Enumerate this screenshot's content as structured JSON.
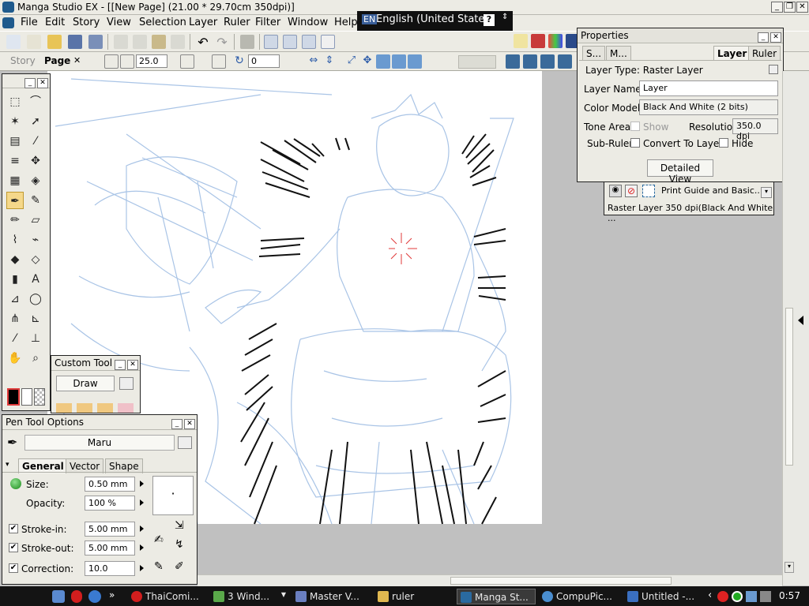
{
  "window": {
    "title": "Manga Studio EX - [[New Page] (21.00 * 29.70cm 350dpi)]",
    "minimize": "_",
    "restore": "❐",
    "close": "✕"
  },
  "menu": [
    "File",
    "Edit",
    "Story",
    "View",
    "Selection",
    "Layer",
    "Ruler",
    "Filter",
    "Window",
    "Help"
  ],
  "language_bar": {
    "code": "EN",
    "label": "English (United States)",
    "help": "?"
  },
  "toolbar2": {
    "story_tab": "Story",
    "page_tab": "Page",
    "page_close": "✕",
    "zoom_value": "25.0",
    "rotate_value": "0"
  },
  "tools_palette": {
    "min": "_",
    "close": "✕",
    "tools": [
      {
        "name": "rect-select-icon",
        "glyph": "⬚"
      },
      {
        "name": "lasso-select-icon",
        "glyph": "⌒"
      },
      {
        "name": "magic-wand-icon",
        "glyph": "✶"
      },
      {
        "name": "object-select-icon",
        "glyph": "➚"
      },
      {
        "name": "layer-select-icon",
        "glyph": "▤"
      },
      {
        "name": "eyedropper-icon",
        "glyph": "⁄"
      },
      {
        "name": "layer-move-icon",
        "glyph": "≡"
      },
      {
        "name": "move-icon",
        "glyph": "✥"
      },
      {
        "name": "grid-icon",
        "glyph": "▦"
      },
      {
        "name": "transform-icon",
        "glyph": "◈"
      },
      {
        "name": "pen-icon",
        "glyph": "✒"
      },
      {
        "name": "marker-icon",
        "glyph": "✎"
      },
      {
        "name": "pencil-icon",
        "glyph": "✏"
      },
      {
        "name": "eraser-icon",
        "glyph": "▱"
      },
      {
        "name": "brush-icon",
        "glyph": "⌇"
      },
      {
        "name": "pattern-brush-icon",
        "glyph": "⌁"
      },
      {
        "name": "fill-icon",
        "glyph": "◆"
      },
      {
        "name": "pattern-fill-icon",
        "glyph": "◇"
      },
      {
        "name": "gradient-icon",
        "glyph": "▮"
      },
      {
        "name": "text-icon",
        "glyph": "A"
      },
      {
        "name": "polyline-icon",
        "glyph": "⊿"
      },
      {
        "name": "ellipse-icon",
        "glyph": "◯"
      },
      {
        "name": "speed-line-icon",
        "glyph": "⋔"
      },
      {
        "name": "ruler-icon",
        "glyph": "⊾"
      },
      {
        "name": "correction-pen-icon",
        "glyph": "⁄"
      },
      {
        "name": "stamp-icon",
        "glyph": "⊥"
      },
      {
        "name": "hand-icon",
        "glyph": "✋"
      },
      {
        "name": "zoom-icon",
        "glyph": "⌕"
      }
    ]
  },
  "custom_tool": {
    "title": "Custom Tool",
    "min": "_",
    "close": "✕",
    "selected": "Draw"
  },
  "pen_options": {
    "title": "Pen Tool Options",
    "min": "_",
    "close": "✕",
    "preset": "Maru",
    "tabs": [
      "General",
      "Vector",
      "Shape"
    ],
    "size_label": "Size:",
    "size_value": "0.50 mm",
    "opacity_label": "Opacity:",
    "opacity_value": "100 %",
    "stroke_in_label": "Stroke-in:",
    "stroke_in_value": "5.00 mm",
    "stroke_out_label": "Stroke-out:",
    "stroke_out_value": "5.00 mm",
    "correction_label": "Correction:",
    "correction_value": "10.0",
    "preview_dot": "·",
    "check": "✔"
  },
  "properties": {
    "title": "Properties",
    "min": "_",
    "close": "✕",
    "tabs": [
      "S...",
      "M...",
      "Layer",
      "Ruler"
    ],
    "layer_type": "Layer Type: Raster Layer",
    "layer_name_label": "Layer Name:",
    "layer_name_value": "Layer",
    "color_model_label": "Color Model:",
    "color_model_value": "Black And White (2 bits)",
    "tone_area_label": "Tone Area:",
    "show_label": "Show",
    "resolution_label": "Resolution:",
    "resolution_value": "350.0 dpi",
    "sub_ruler_label": "Sub-Ruler:",
    "convert_label": "Convert To Layer",
    "hide_label": "Hide",
    "detailed_view": "Detailed View"
  },
  "layers": {
    "layer1_name": "Print Guide and Basic...",
    "layer2_name": "Raster Layer 350 dpi(Black And White ..."
  },
  "taskbar": {
    "chevron": "»",
    "tasks": [
      {
        "label": "ThaiComi...",
        "color": "#d21e1e"
      },
      {
        "label": "3 Wind...",
        "color": "#5aa84a"
      },
      {
        "label": "Master V...",
        "color": "#6a7fc0"
      },
      {
        "label": "ruler",
        "color": "#e0b850"
      },
      {
        "label": "Manga St...",
        "color": "#2a6aa0"
      },
      {
        "label": "CompuPic...",
        "color": "#4a8ed0"
      },
      {
        "label": "Untitled -...",
        "color": "#3a6fc0"
      }
    ],
    "tray_chevron": "‹",
    "clock": "0:57"
  }
}
